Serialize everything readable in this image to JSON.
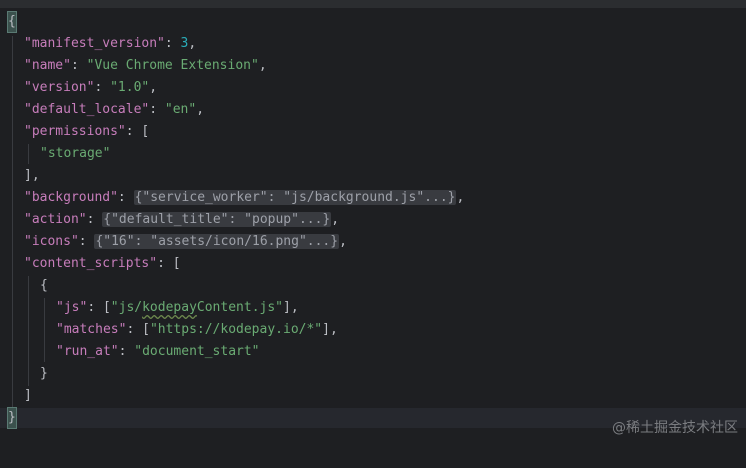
{
  "code": {
    "open_brace": "{",
    "close_brace": "}",
    "manifest_version_key": "\"manifest_version\"",
    "manifest_version_val": "3",
    "name_key": "\"name\"",
    "name_val": "\"Vue Chrome Extension\"",
    "version_key": "\"version\"",
    "version_val": "\"1.0\"",
    "default_locale_key": "\"default_locale\"",
    "default_locale_val": "\"en\"",
    "permissions_key": "\"permissions\"",
    "permissions_item": "\"storage\"",
    "background_key": "\"background\"",
    "background_fold": "{\"service_worker\": \"js/background.js\"...}",
    "action_key": "\"action\"",
    "action_fold": "{\"default_title\": \"popup\"...}",
    "icons_key": "\"icons\"",
    "icons_fold": "{\"16\": \"assets/icon/16.png\"...}",
    "content_scripts_key": "\"content_scripts\"",
    "js_key": "\"js\"",
    "js_val_prefix": "\"js/",
    "js_val_word": "kodepay",
    "js_val_suffix": "Content.js\"",
    "matches_key": "\"matches\"",
    "matches_val": "\"https://kodepay.io/*\"",
    "run_at_key": "\"run_at\"",
    "run_at_val": "\"document_start\""
  },
  "watermark": "@稀土掘金技术社区"
}
